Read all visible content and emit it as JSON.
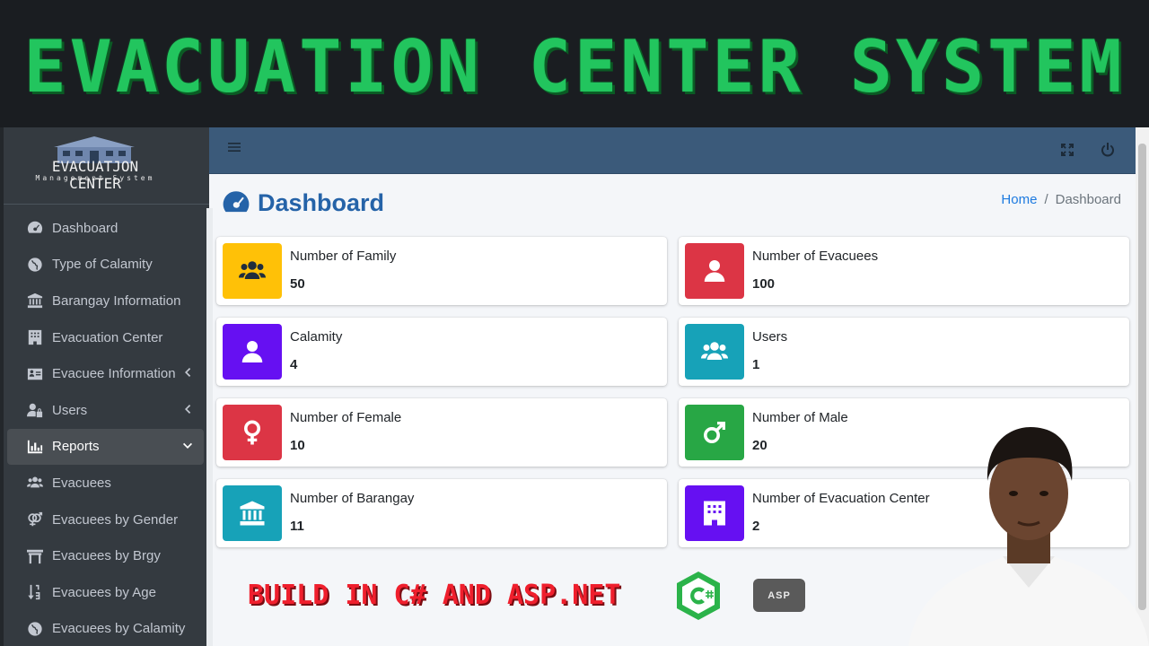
{
  "banner": {
    "title": "EVACUATION CENTER SYSTEM"
  },
  "brand": {
    "name": "EVACUATJON CENTER",
    "subtitle": "Management System"
  },
  "sidebar": {
    "items": [
      {
        "label": "Dashboard",
        "icon": "tachometer-icon"
      },
      {
        "label": "Type of Calamity",
        "icon": "globe-icon"
      },
      {
        "label": "Barangay Information",
        "icon": "landmark-icon"
      },
      {
        "label": "Evacuation Center",
        "icon": "building-icon"
      },
      {
        "label": "Evacuee Information",
        "icon": "id-card-icon",
        "caret": "chevron-left-icon"
      },
      {
        "label": "Users",
        "icon": "user-lock-icon",
        "caret": "chevron-left-icon"
      },
      {
        "label": "Reports",
        "icon": "chart-bar-icon",
        "caret": "chevron-down-icon",
        "active": true
      },
      {
        "label": "Evacuees",
        "icon": "users-icon"
      },
      {
        "label": "Evacuees by Gender",
        "icon": "venus-mars-icon"
      },
      {
        "label": "Evacuees by Brgy",
        "icon": "torii-gate-icon"
      },
      {
        "label": "Evacuees by Age",
        "icon": "sort-numeric-icon"
      },
      {
        "label": "Evacuees by Calamity",
        "icon": "globe-icon"
      }
    ]
  },
  "header": {
    "page_title": "Dashboard",
    "breadcrumb_home": "Home",
    "breadcrumb_current": "Dashboard"
  },
  "boxes": [
    {
      "label": "Number of Family",
      "value": "50",
      "color": "#ffc107",
      "icon": "users-icon"
    },
    {
      "label": "Number of Evacuees",
      "value": "100",
      "color": "#dc3545",
      "icon": "user-icon"
    },
    {
      "label": "Calamity",
      "value": "4",
      "color": "#6610f2",
      "icon": "user-icon"
    },
    {
      "label": "Users",
      "value": "1",
      "color": "#17a2b8",
      "icon": "users-icon"
    },
    {
      "label": "Number of Female",
      "value": "10",
      "color": "#dc3545",
      "icon": "venus-icon"
    },
    {
      "label": "Number of Male",
      "value": "20",
      "color": "#28a745",
      "icon": "mars-icon"
    },
    {
      "label": "Number of Barangay",
      "value": "11",
      "color": "#17a2b8",
      "icon": "landmark-icon"
    },
    {
      "label": "Number of Evacuation Center",
      "value": "2",
      "color": "#6610f2",
      "icon": "building-icon"
    }
  ],
  "promo": {
    "text": "BUILD IN C# AND ASP.NET",
    "asp_label": "ASP"
  }
}
